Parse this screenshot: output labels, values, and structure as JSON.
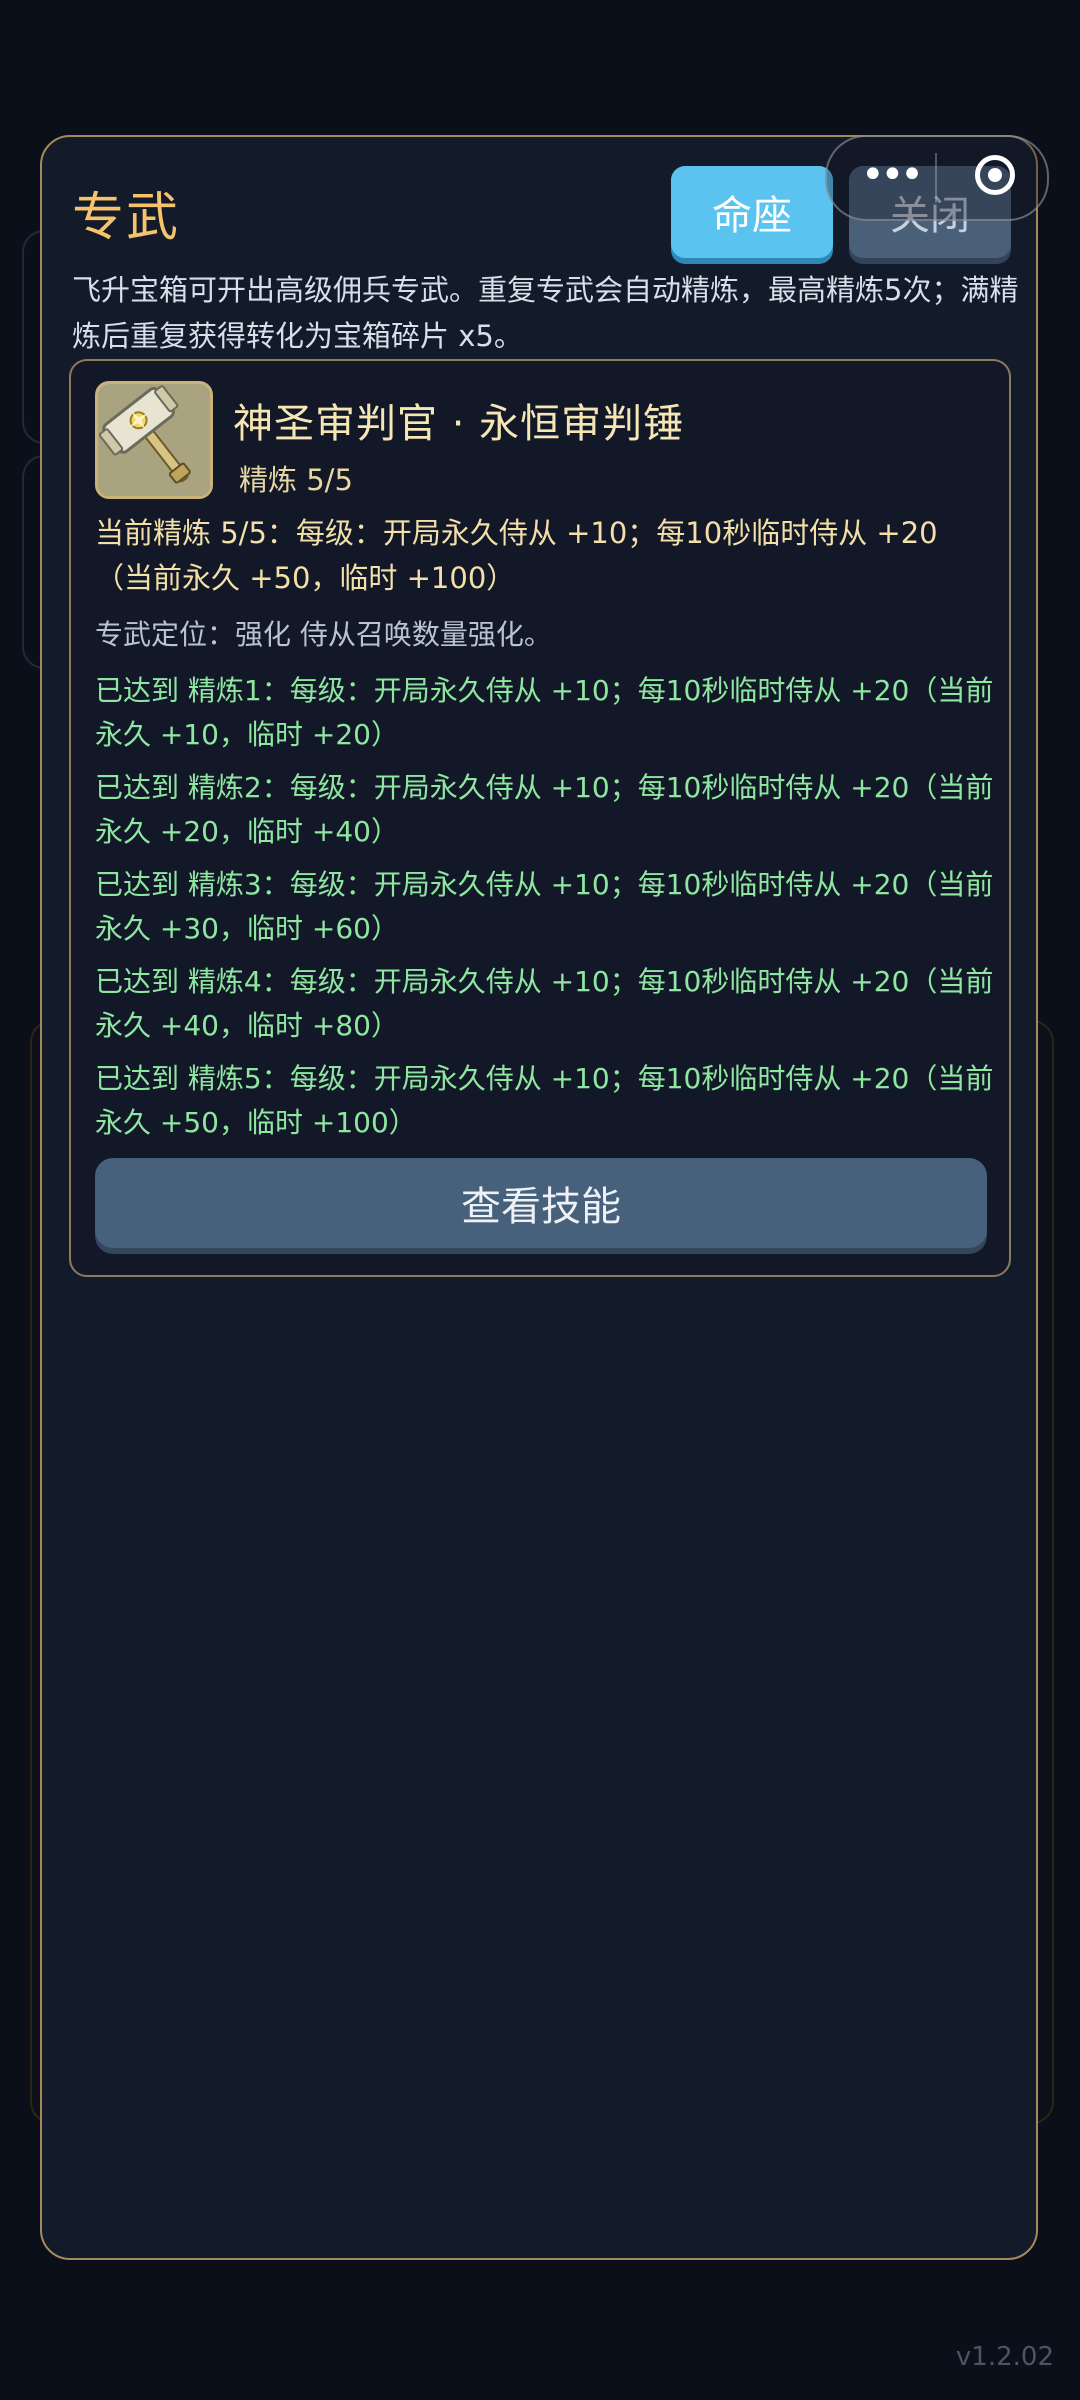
{
  "capsule": {
    "more_icon": "more-dots-icon",
    "target_icon": "target-icon"
  },
  "modal": {
    "title": "专武",
    "constellation_button": "命座",
    "close_button": "关闭",
    "intro": "飞升宝箱可开出高级佣兵专武。重复专武会自动精炼，最高精炼5次；满精炼后重复获得转化为宝箱碎片 x5。"
  },
  "weapon": {
    "icon": "hammer-icon",
    "name": "神圣审判官 · 永恒审判锤",
    "refine_level": "精炼 5/5",
    "current_effect": "当前精炼 5/5：每级：开局永久侍从 +10；每10秒临时侍从 +20（当前永久 +50，临时 +100）",
    "positioning": "专武定位：强化 侍从召唤数量强化。",
    "refinements": [
      "已达到 精炼1：每级：开局永久侍从 +10；每10秒临时侍从 +20（当前永久 +10，临时 +20）",
      "已达到 精炼2：每级：开局永久侍从 +10；每10秒临时侍从 +20（当前永久 +20，临时 +40）",
      "已达到 精炼3：每级：开局永久侍从 +10；每10秒临时侍从 +20（当前永久 +30，临时 +60）",
      "已达到 精炼4：每级：开局永久侍从 +10；每10秒临时侍从 +20（当前永久 +40，临时 +80）",
      "已达到 精炼5：每级：开局永久侍从 +10；每10秒临时侍从 +20（当前永久 +50，临时 +100）"
    ],
    "view_skill_button": "查看技能"
  },
  "version": "v1.2.02",
  "colors": {
    "title_gold": "#f5c36b",
    "primary_button": "#5ac3f0",
    "secondary_button": "#4a5f78",
    "achieved_green": "#8ee6a0",
    "modal_border": "#a5895b"
  }
}
